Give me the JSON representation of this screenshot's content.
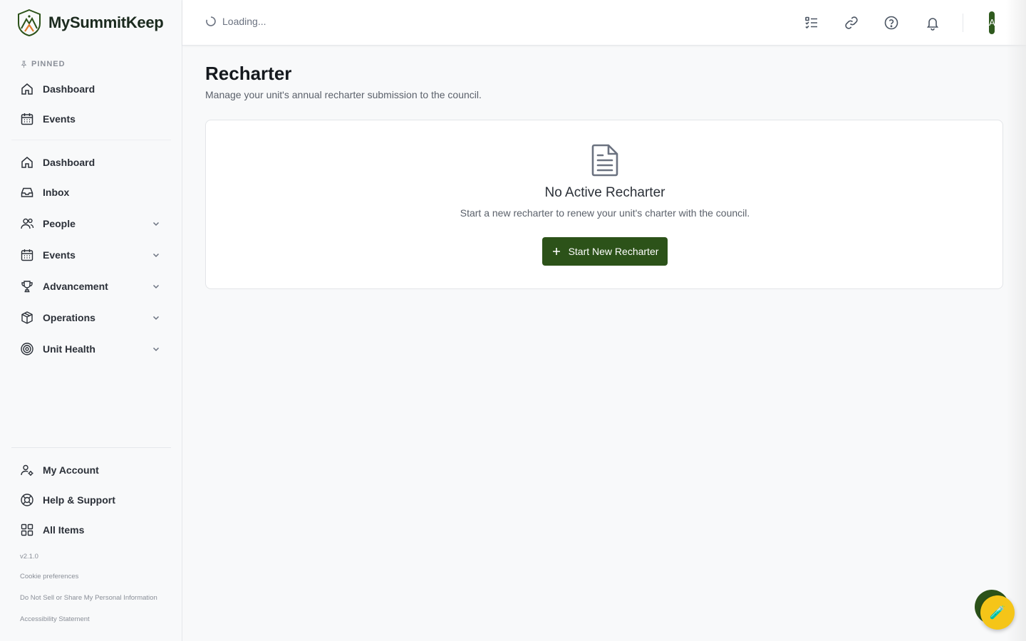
{
  "brand": {
    "name": "MySummitKeep"
  },
  "sidebar": {
    "pinned_label": "PINNED",
    "pinned": [
      {
        "label": "Dashboard",
        "icon": "home-icon"
      },
      {
        "label": "Events",
        "icon": "calendar-icon"
      }
    ],
    "items": [
      {
        "label": "Dashboard",
        "icon": "home-icon",
        "expandable": false
      },
      {
        "label": "Inbox",
        "icon": "inbox-icon",
        "expandable": false
      },
      {
        "label": "People",
        "icon": "users-icon",
        "expandable": true
      },
      {
        "label": "Events",
        "icon": "calendar-icon",
        "expandable": true
      },
      {
        "label": "Advancement",
        "icon": "trophy-icon",
        "expandable": true
      },
      {
        "label": "Operations",
        "icon": "box-icon",
        "expandable": true
      },
      {
        "label": "Unit Health",
        "icon": "target-icon",
        "expandable": true
      }
    ],
    "bottom": [
      {
        "label": "My Account",
        "icon": "user-cog-icon"
      },
      {
        "label": "Help & Support",
        "icon": "lifebuoy-icon"
      },
      {
        "label": "All Items",
        "icon": "grid-icon"
      }
    ],
    "version": "v2.1.0",
    "footer_links": [
      "Cookie preferences",
      "Do Not Sell or Share My Personal Information",
      "Accessibility Statement"
    ]
  },
  "topbar": {
    "loading_text": "Loading...",
    "icons": [
      "checklist-icon",
      "link-icon",
      "help-circle-icon",
      "bell-icon"
    ],
    "avatar_initial": "A"
  },
  "page": {
    "title": "Recharter",
    "subtitle": "Manage your unit's annual recharter submission to the council."
  },
  "empty_state": {
    "icon": "file-text-icon",
    "title": "No Active Recharter",
    "description": "Start a new recharter to renew your unit's charter with the council.",
    "button_label": "Start New Recharter"
  },
  "colors": {
    "primary": "#2c5219",
    "fab": "#f5c518"
  }
}
